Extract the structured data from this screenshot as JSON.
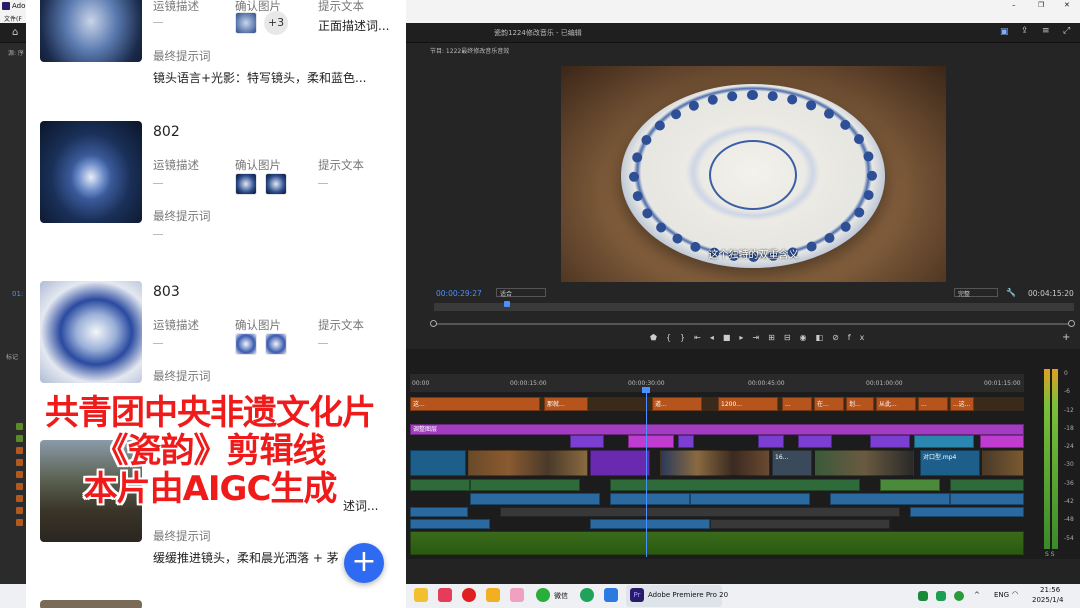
{
  "premiere": {
    "app_title": "Ado",
    "menu_file": "文件(F",
    "project_title": "瓷韵1224修改音乐 - 已编辑",
    "source_tab": "源: 序",
    "program_tab": "节目: 1222最终修改音乐音效",
    "subtitle": "这个独特的双重含义",
    "timecode_current": "00:00:29:27",
    "zoom_fit": "适合",
    "quality": "完整",
    "timecode_total": "00:04:15:20",
    "left_timecode": "01:",
    "marker_panel": "标记",
    "ruler_ticks": [
      "00:00",
      "00:00:15:00",
      "00:00:30:00",
      "00:00:45:00",
      "00:01:00:00",
      "00:01:15:00"
    ],
    "adjustment_layer": "调整图层",
    "caption_clips": [
      "这...",
      "那就...",
      "道...",
      "1200...",
      "...",
      "在...",
      "划...",
      "从此...",
      "...",
      "...这..."
    ],
    "video_clip_label_1": "16...",
    "video_clip_label_2": "对口型.mp4",
    "meter_scale": [
      "0",
      "-6",
      "-12",
      "-18",
      "-24",
      "-30",
      "-36",
      "-42",
      "-48",
      "-54"
    ],
    "meter_footer": "S  S",
    "taskbar": {
      "wechat": "微信",
      "premiere": "Adobe Premiere Pro 20",
      "lang": "ENG",
      "time": "21:56",
      "date": "2025/1/4"
    }
  },
  "app": {
    "card0": {
      "label_camera": "运镜描述",
      "label_images": "确认图片",
      "more_count": "+3",
      "label_prompt": "提示文本",
      "prompt_text": "正面描述词...",
      "label_final": "最终提示词",
      "final_text": "镜头语言+光影：特写镜头，柔和蓝色..."
    },
    "card1": {
      "id": "802",
      "label_camera": "运镜描述",
      "label_images": "确认图片",
      "label_prompt": "提示文本",
      "label_final": "最终提示词"
    },
    "card2": {
      "id": "803",
      "label_camera": "运镜描述",
      "label_images": "确认图片",
      "label_prompt": "提示文本",
      "label_final": "最终提示词"
    },
    "card3": {
      "prompt_text": "述词...",
      "label_final": "最终提示词",
      "final_text": "缓缓推进镜头，柔和晨光洒落 + 茅"
    },
    "fab_label": "+"
  },
  "overlay": {
    "line1": "共青团中央非遗文化片",
    "line2": "《瓷韵》剪辑线",
    "line3": "本片由AIGC生成"
  }
}
